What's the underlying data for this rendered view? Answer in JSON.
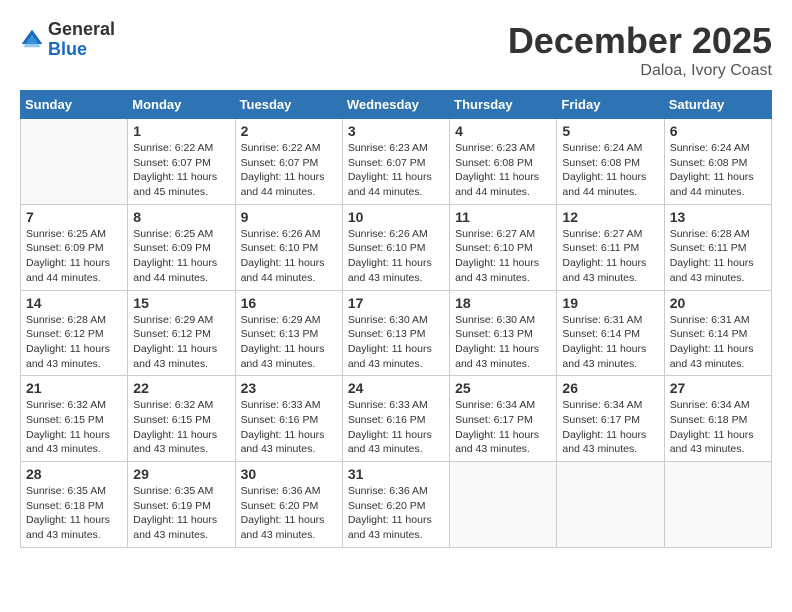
{
  "header": {
    "logo_general": "General",
    "logo_blue": "Blue",
    "month_title": "December 2025",
    "location": "Daloa, Ivory Coast"
  },
  "days_of_week": [
    "Sunday",
    "Monday",
    "Tuesday",
    "Wednesday",
    "Thursday",
    "Friday",
    "Saturday"
  ],
  "weeks": [
    [
      {
        "day": "",
        "info": ""
      },
      {
        "day": "1",
        "info": "Sunrise: 6:22 AM\nSunset: 6:07 PM\nDaylight: 11 hours and 45 minutes."
      },
      {
        "day": "2",
        "info": "Sunrise: 6:22 AM\nSunset: 6:07 PM\nDaylight: 11 hours and 44 minutes."
      },
      {
        "day": "3",
        "info": "Sunrise: 6:23 AM\nSunset: 6:07 PM\nDaylight: 11 hours and 44 minutes."
      },
      {
        "day": "4",
        "info": "Sunrise: 6:23 AM\nSunset: 6:08 PM\nDaylight: 11 hours and 44 minutes."
      },
      {
        "day": "5",
        "info": "Sunrise: 6:24 AM\nSunset: 6:08 PM\nDaylight: 11 hours and 44 minutes."
      },
      {
        "day": "6",
        "info": "Sunrise: 6:24 AM\nSunset: 6:08 PM\nDaylight: 11 hours and 44 minutes."
      }
    ],
    [
      {
        "day": "7",
        "info": "Sunrise: 6:25 AM\nSunset: 6:09 PM\nDaylight: 11 hours and 44 minutes."
      },
      {
        "day": "8",
        "info": "Sunrise: 6:25 AM\nSunset: 6:09 PM\nDaylight: 11 hours and 44 minutes."
      },
      {
        "day": "9",
        "info": "Sunrise: 6:26 AM\nSunset: 6:10 PM\nDaylight: 11 hours and 44 minutes."
      },
      {
        "day": "10",
        "info": "Sunrise: 6:26 AM\nSunset: 6:10 PM\nDaylight: 11 hours and 43 minutes."
      },
      {
        "day": "11",
        "info": "Sunrise: 6:27 AM\nSunset: 6:10 PM\nDaylight: 11 hours and 43 minutes."
      },
      {
        "day": "12",
        "info": "Sunrise: 6:27 AM\nSunset: 6:11 PM\nDaylight: 11 hours and 43 minutes."
      },
      {
        "day": "13",
        "info": "Sunrise: 6:28 AM\nSunset: 6:11 PM\nDaylight: 11 hours and 43 minutes."
      }
    ],
    [
      {
        "day": "14",
        "info": "Sunrise: 6:28 AM\nSunset: 6:12 PM\nDaylight: 11 hours and 43 minutes."
      },
      {
        "day": "15",
        "info": "Sunrise: 6:29 AM\nSunset: 6:12 PM\nDaylight: 11 hours and 43 minutes."
      },
      {
        "day": "16",
        "info": "Sunrise: 6:29 AM\nSunset: 6:13 PM\nDaylight: 11 hours and 43 minutes."
      },
      {
        "day": "17",
        "info": "Sunrise: 6:30 AM\nSunset: 6:13 PM\nDaylight: 11 hours and 43 minutes."
      },
      {
        "day": "18",
        "info": "Sunrise: 6:30 AM\nSunset: 6:13 PM\nDaylight: 11 hours and 43 minutes."
      },
      {
        "day": "19",
        "info": "Sunrise: 6:31 AM\nSunset: 6:14 PM\nDaylight: 11 hours and 43 minutes."
      },
      {
        "day": "20",
        "info": "Sunrise: 6:31 AM\nSunset: 6:14 PM\nDaylight: 11 hours and 43 minutes."
      }
    ],
    [
      {
        "day": "21",
        "info": "Sunrise: 6:32 AM\nSunset: 6:15 PM\nDaylight: 11 hours and 43 minutes."
      },
      {
        "day": "22",
        "info": "Sunrise: 6:32 AM\nSunset: 6:15 PM\nDaylight: 11 hours and 43 minutes."
      },
      {
        "day": "23",
        "info": "Sunrise: 6:33 AM\nSunset: 6:16 PM\nDaylight: 11 hours and 43 minutes."
      },
      {
        "day": "24",
        "info": "Sunrise: 6:33 AM\nSunset: 6:16 PM\nDaylight: 11 hours and 43 minutes."
      },
      {
        "day": "25",
        "info": "Sunrise: 6:34 AM\nSunset: 6:17 PM\nDaylight: 11 hours and 43 minutes."
      },
      {
        "day": "26",
        "info": "Sunrise: 6:34 AM\nSunset: 6:17 PM\nDaylight: 11 hours and 43 minutes."
      },
      {
        "day": "27",
        "info": "Sunrise: 6:34 AM\nSunset: 6:18 PM\nDaylight: 11 hours and 43 minutes."
      }
    ],
    [
      {
        "day": "28",
        "info": "Sunrise: 6:35 AM\nSunset: 6:18 PM\nDaylight: 11 hours and 43 minutes."
      },
      {
        "day": "29",
        "info": "Sunrise: 6:35 AM\nSunset: 6:19 PM\nDaylight: 11 hours and 43 minutes."
      },
      {
        "day": "30",
        "info": "Sunrise: 6:36 AM\nSunset: 6:20 PM\nDaylight: 11 hours and 43 minutes."
      },
      {
        "day": "31",
        "info": "Sunrise: 6:36 AM\nSunset: 6:20 PM\nDaylight: 11 hours and 43 minutes."
      },
      {
        "day": "",
        "info": ""
      },
      {
        "day": "",
        "info": ""
      },
      {
        "day": "",
        "info": ""
      }
    ]
  ]
}
